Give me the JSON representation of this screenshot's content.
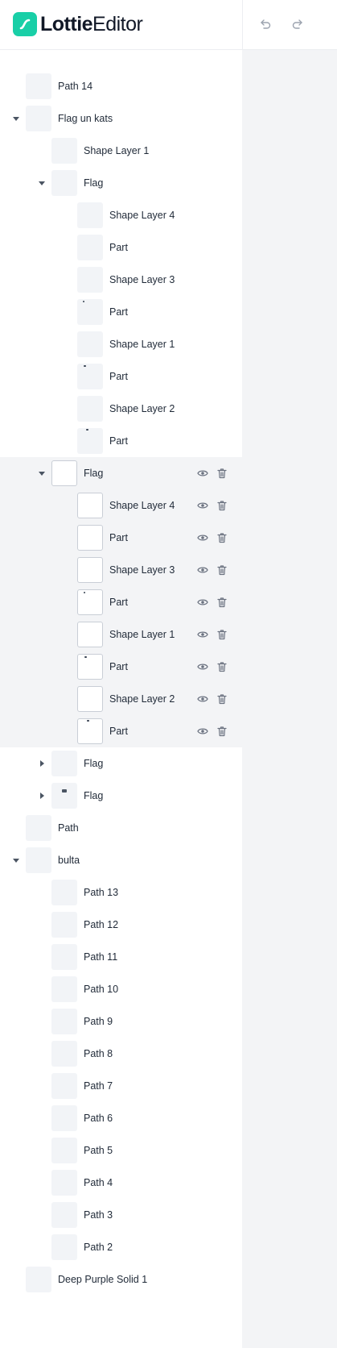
{
  "app": {
    "logo_bold": "Lottie",
    "logo_light": "Editor",
    "logo_icon": "lottie-s-icon",
    "accent_color": "#19cfa7"
  },
  "toolbar": {
    "undo_icon": "undo-icon",
    "redo_icon": "redo-icon"
  },
  "colors": {
    "canvas_bg": "#f3f4f6",
    "highlight_bg": "#f3f4f6",
    "text": "#1f2937",
    "icon": "#6b7280"
  },
  "layers": [
    {
      "label": "Path 14",
      "depth": 0,
      "caret": "none",
      "highlight": false,
      "thumb": "",
      "actions": false
    },
    {
      "label": "Flag un kats",
      "depth": 0,
      "caret": "down",
      "highlight": false,
      "thumb": "",
      "actions": false
    },
    {
      "label": "Shape Layer 1",
      "depth": 1,
      "caret": "none",
      "highlight": false,
      "thumb": "",
      "actions": false
    },
    {
      "label": "Flag",
      "depth": 1,
      "caret": "down",
      "highlight": false,
      "thumb": "",
      "actions": false
    },
    {
      "label": "Shape Layer 4",
      "depth": 2,
      "caret": "none",
      "highlight": false,
      "thumb": "",
      "actions": false
    },
    {
      "label": "Part",
      "depth": 2,
      "caret": "none",
      "highlight": false,
      "thumb": "",
      "actions": false
    },
    {
      "label": "Shape Layer 3",
      "depth": 2,
      "caret": "none",
      "highlight": false,
      "thumb": "",
      "actions": false
    },
    {
      "label": "Part",
      "depth": 2,
      "caret": "none",
      "highlight": false,
      "thumb": "dot-topleft",
      "actions": false
    },
    {
      "label": "Shape Layer 1",
      "depth": 2,
      "caret": "none",
      "highlight": false,
      "thumb": "",
      "actions": false
    },
    {
      "label": "Part",
      "depth": 2,
      "caret": "none",
      "highlight": false,
      "thumb": "dot-left",
      "actions": false
    },
    {
      "label": "Shape Layer 2",
      "depth": 2,
      "caret": "none",
      "highlight": false,
      "thumb": "",
      "actions": false
    },
    {
      "label": "Part",
      "depth": 2,
      "caret": "none",
      "highlight": false,
      "thumb": "dot-mid",
      "actions": false
    },
    {
      "label": "Flag",
      "depth": 1,
      "caret": "down",
      "highlight": true,
      "thumb": "",
      "actions": true
    },
    {
      "label": "Shape Layer 4",
      "depth": 2,
      "caret": "none",
      "highlight": true,
      "thumb": "",
      "actions": true
    },
    {
      "label": "Part",
      "depth": 2,
      "caret": "none",
      "highlight": true,
      "thumb": "",
      "actions": true
    },
    {
      "label": "Shape Layer 3",
      "depth": 2,
      "caret": "none",
      "highlight": true,
      "thumb": "",
      "actions": true
    },
    {
      "label": "Part",
      "depth": 2,
      "caret": "none",
      "highlight": true,
      "thumb": "dot-topleft",
      "actions": true
    },
    {
      "label": "Shape Layer 1",
      "depth": 2,
      "caret": "none",
      "highlight": true,
      "thumb": "",
      "actions": true
    },
    {
      "label": "Part",
      "depth": 2,
      "caret": "none",
      "highlight": true,
      "thumb": "dot-left",
      "actions": true
    },
    {
      "label": "Shape Layer 2",
      "depth": 2,
      "caret": "none",
      "highlight": true,
      "thumb": "",
      "actions": true
    },
    {
      "label": "Part",
      "depth": 2,
      "caret": "none",
      "highlight": true,
      "thumb": "dot-mid",
      "actions": true
    },
    {
      "label": "Flag",
      "depth": 1,
      "caret": "right",
      "highlight": false,
      "thumb": "",
      "actions": false
    },
    {
      "label": "Flag",
      "depth": 1,
      "caret": "right",
      "highlight": false,
      "thumb": "flag-mini",
      "actions": false
    },
    {
      "label": "Path",
      "depth": 0,
      "caret": "none",
      "highlight": false,
      "thumb": "",
      "actions": false
    },
    {
      "label": "bulta",
      "depth": 0,
      "caret": "down",
      "highlight": false,
      "thumb": "",
      "actions": false
    },
    {
      "label": "Path 13",
      "depth": 1,
      "caret": "none",
      "highlight": false,
      "thumb": "",
      "actions": false
    },
    {
      "label": "Path 12",
      "depth": 1,
      "caret": "none",
      "highlight": false,
      "thumb": "",
      "actions": false
    },
    {
      "label": "Path 11",
      "depth": 1,
      "caret": "none",
      "highlight": false,
      "thumb": "",
      "actions": false
    },
    {
      "label": "Path 10",
      "depth": 1,
      "caret": "none",
      "highlight": false,
      "thumb": "",
      "actions": false
    },
    {
      "label": "Path 9",
      "depth": 1,
      "caret": "none",
      "highlight": false,
      "thumb": "",
      "actions": false
    },
    {
      "label": "Path 8",
      "depth": 1,
      "caret": "none",
      "highlight": false,
      "thumb": "",
      "actions": false
    },
    {
      "label": "Path 7",
      "depth": 1,
      "caret": "none",
      "highlight": false,
      "thumb": "",
      "actions": false
    },
    {
      "label": "Path 6",
      "depth": 1,
      "caret": "none",
      "highlight": false,
      "thumb": "",
      "actions": false
    },
    {
      "label": "Path 5",
      "depth": 1,
      "caret": "none",
      "highlight": false,
      "thumb": "",
      "actions": false
    },
    {
      "label": "Path 4",
      "depth": 1,
      "caret": "none",
      "highlight": false,
      "thumb": "",
      "actions": false
    },
    {
      "label": "Path 3",
      "depth": 1,
      "caret": "none",
      "highlight": false,
      "thumb": "",
      "actions": false
    },
    {
      "label": "Path 2",
      "depth": 1,
      "caret": "none",
      "highlight": false,
      "thumb": "",
      "actions": false
    },
    {
      "label": "Deep Purple Solid 1",
      "depth": 0,
      "caret": "none",
      "highlight": false,
      "thumb": "",
      "actions": false
    }
  ]
}
